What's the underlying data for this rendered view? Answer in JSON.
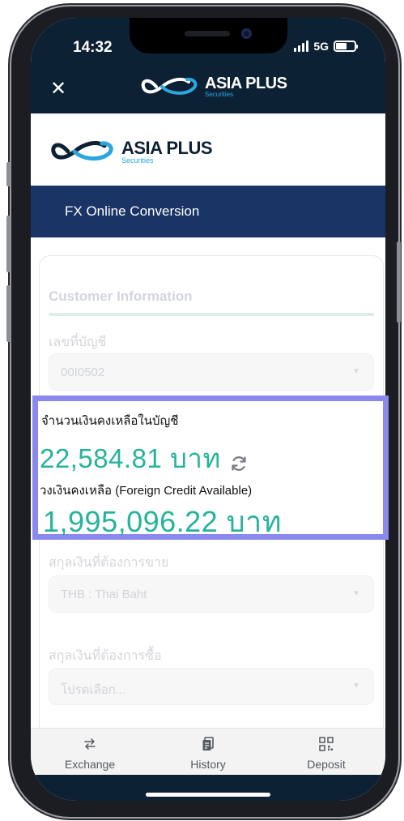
{
  "status_bar": {
    "time": "14:32",
    "network": "5G"
  },
  "top_bar": {
    "close_icon": "close-icon",
    "logo_main": "ASIA PLUS",
    "logo_sub": "Securities"
  },
  "header": {
    "logo_main": "ASIA PLUS",
    "logo_sub": "Securities"
  },
  "section_band": {
    "title": "FX Online Conversion"
  },
  "form": {
    "section_title": "Customer Information",
    "account_label": "เลขที่บัญชี",
    "account_value": "00I0502",
    "sell_currency_label": "สกุลเงินที่ต้องการขาย",
    "sell_currency_value": "THB : Thai Baht",
    "buy_currency_label": "สกุลเงินที่ต้องการซื้อ",
    "buy_currency_placeholder": "โปรดเลือก..."
  },
  "balances": {
    "balance_label": "จำนวนเงินคงเหลือในบัญชี",
    "balance_amount": "22,584.81 บาท",
    "credit_label": "วงเงินคงเหลือ (Foreign Credit Available)",
    "credit_amount": "1,995,096.22 บาท"
  },
  "tabs": [
    {
      "label": "Exchange",
      "icon": "exchange-icon"
    },
    {
      "label": "History",
      "icon": "history-icon"
    },
    {
      "label": "Deposit",
      "icon": "qr-code-icon"
    }
  ],
  "colors": {
    "navy": "#0d2134",
    "band": "#1a3466",
    "accent_green": "#26b39a",
    "highlight": "#8b88ee",
    "brand_blue": "#2aa7df"
  }
}
